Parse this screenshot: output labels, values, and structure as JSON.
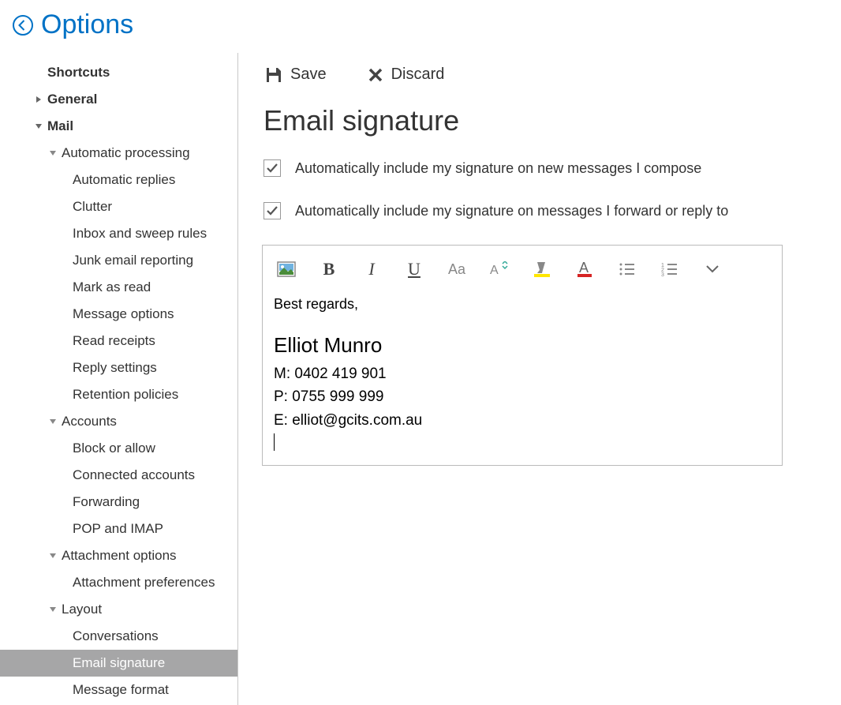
{
  "header": {
    "title": "Options"
  },
  "sidebar": {
    "shortcuts": "Shortcuts",
    "general": "General",
    "mail": "Mail",
    "automatic_processing": "Automatic processing",
    "automatic_replies": "Automatic replies",
    "clutter": "Clutter",
    "inbox_rules": "Inbox and sweep rules",
    "junk": "Junk email reporting",
    "mark_as_read": "Mark as read",
    "message_options": "Message options",
    "read_receipts": "Read receipts",
    "reply_settings": "Reply settings",
    "retention": "Retention policies",
    "accounts": "Accounts",
    "block_allow": "Block or allow",
    "connected": "Connected accounts",
    "forwarding": "Forwarding",
    "pop_imap": "POP and IMAP",
    "attachment_options": "Attachment options",
    "attachment_prefs": "Attachment preferences",
    "layout": "Layout",
    "conversations": "Conversations",
    "email_signature": "Email signature",
    "message_format": "Message format"
  },
  "toolbar": {
    "save": "Save",
    "discard": "Discard"
  },
  "page": {
    "title": "Email signature",
    "check1": "Automatically include my signature on new messages I compose",
    "check2": "Automatically include my signature on messages I forward or reply to"
  },
  "signature": {
    "intro": "Best regards,",
    "name": "Elliot Munro",
    "mobile": "M: 0402 419 901",
    "phone": "P: 0755 999 999",
    "email": "E: elliot@gcits.com.au"
  }
}
